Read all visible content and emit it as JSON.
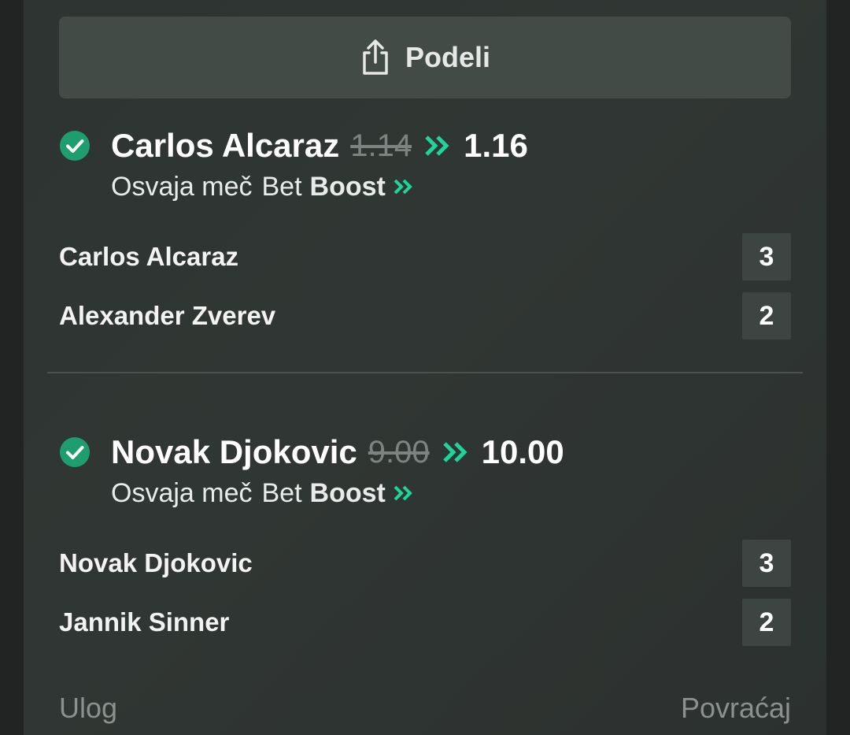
{
  "share": {
    "label": "Podeli",
    "icon": "share-icon"
  },
  "bets": [
    {
      "name": "Carlos Alcaraz",
      "old_odd": "1.14",
      "new_odd": "1.16",
      "market": "Osvaja meč",
      "bet_prefix": "Bet",
      "boost": "Boost",
      "rows": [
        {
          "name": "Carlos Alcaraz",
          "score": "3"
        },
        {
          "name": "Alexander Zverev",
          "score": "2"
        }
      ]
    },
    {
      "name": "Novak Djokovic",
      "old_odd": "9.00",
      "new_odd": "10.00",
      "market": "Osvaja meč",
      "bet_prefix": "Bet",
      "boost": "Boost",
      "rows": [
        {
          "name": "Novak Djokovic",
          "score": "3"
        },
        {
          "name": "Jannik Sinner",
          "score": "2"
        }
      ]
    }
  ],
  "footer": {
    "stake_label": "Ulog",
    "return_label": "Povraćaj"
  },
  "colors": {
    "accent_green": "#1fd49a",
    "check_green": "#1e9e6f",
    "panel": "#2f3532",
    "button": "#434b47"
  }
}
